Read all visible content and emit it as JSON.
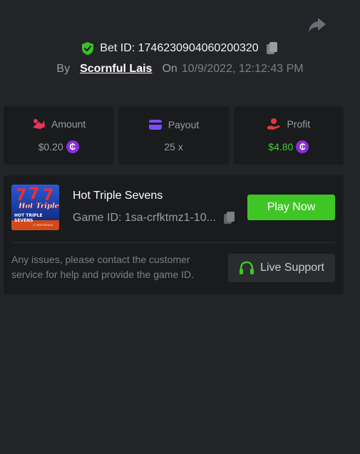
{
  "header": {
    "bet_id_label": "Bet ID: 1746230904060200320",
    "by_label": "By",
    "username": "Scornful Lais",
    "on_label": "On",
    "date": "10/9/2022, 12:12:43 PM"
  },
  "stats": {
    "amount": {
      "label": "Amount",
      "value": "$0.20"
    },
    "payout": {
      "label": "Payout",
      "value": "25 x"
    },
    "profit": {
      "label": "Profit",
      "value": "$4.80"
    }
  },
  "game": {
    "title": "Hot Triple Sevens",
    "game_id": "Game ID: 1sa-crfktmz1-10...",
    "thumb_text_line1": "Hot Triple",
    "thumb_text_line2": "HOT TRIPLE",
    "thumb_text_line3": "SEVENS",
    "thumb_text_line4": "© ENDORPHINA",
    "play_label": "Play Now"
  },
  "support": {
    "issues_text": "Any issues, please contact the customer service for help and provide the game ID.",
    "button_label": "Live Support"
  },
  "colors": {
    "accent_green": "#3fc626",
    "coin_purple": "#8b2be2",
    "amount_icon": "#e8365a",
    "payout_icon": "#7c4dff",
    "profit_icon": "#e03a3a"
  },
  "icons": {
    "share": "share-arrow-icon",
    "shield": "shield-check-icon",
    "copy": "copy-icon",
    "coin": "coin-icon",
    "headset": "headset-icon"
  },
  "coin_symbol": "₵"
}
